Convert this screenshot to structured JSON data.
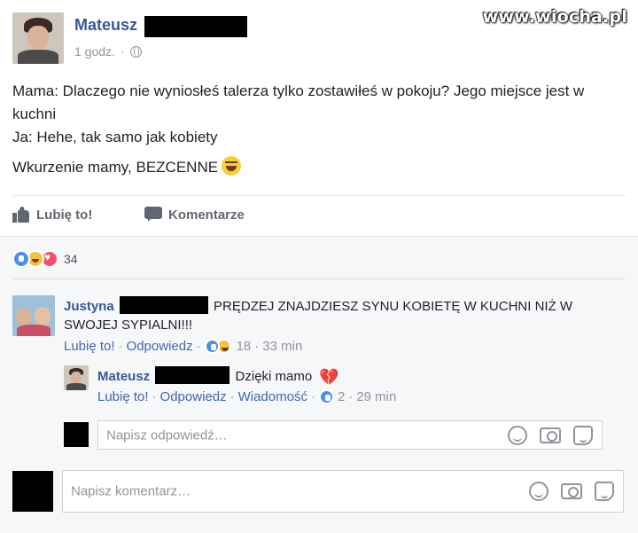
{
  "watermark": "www.wiocha.pl",
  "post": {
    "author": "Mateusz",
    "time": "1 godz.",
    "separator": "·",
    "lines": [
      "Mama: Dlaczego nie wyniosłeś talerza tylko zostawiłeś w pokoju? Jego miejsce jest w kuchni",
      "Ja: Hehe, tak samo jak kobiety"
    ],
    "last_line": "Wkurzenie mamy, BEZCENNE",
    "actions": {
      "like": "Lubię to!",
      "comment": "Komentarze"
    },
    "reaction_count": "34"
  },
  "comments": [
    {
      "name": "Justyna",
      "text": "PRĘDZEJ ZNAJDZIESZ SYNU KOBIETĘ W KUCHNI NIŻ W  SWOJEJ SYPIALNI!!!",
      "like": "Lubię to!",
      "reply": "Odpowiedz",
      "sep": "·",
      "reactions": "18",
      "time": "33 min"
    }
  ],
  "reply": {
    "name": "Mateusz",
    "text": "Dzięki mamo",
    "like": "Lubię to!",
    "reply": "Odpowiedz",
    "message": "Wiadomość",
    "sep": "·",
    "reactions": "2",
    "time": "29 min"
  },
  "reply_input": {
    "placeholder": "Napisz odpowiedź…"
  },
  "comment_input": {
    "placeholder": "Napisz komentarz…"
  },
  "icons": [
    "globe-icon",
    "like-icon",
    "comment-icon",
    "smile-icon",
    "camera-icon",
    "sticker-icon",
    "broken-heart-icon"
  ],
  "colors": {
    "name": "#365899",
    "link": "#4267b2",
    "muted": "#90949c",
    "comments_bg": "#f6f7f9"
  }
}
